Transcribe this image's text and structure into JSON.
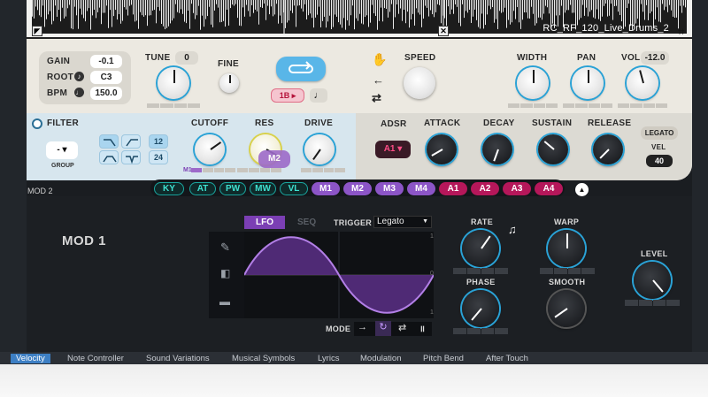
{
  "waveform": {
    "file_name": "RC_RF_120_Live_Drums_2"
  },
  "global": {
    "gain_label": "GAIN",
    "gain_value": "-0.1",
    "root_label": "ROOT",
    "root_value": "C3",
    "bpm_label": "BPM",
    "bpm_value": "150.0"
  },
  "tune": {
    "label": "TUNE",
    "value": "0"
  },
  "fine": {
    "label": "FINE"
  },
  "playback": {
    "slice_label": "1B"
  },
  "speed": {
    "label": "SPEED"
  },
  "width": {
    "label": "WIDTH"
  },
  "pan": {
    "label": "PAN"
  },
  "vol": {
    "label": "VOL",
    "value": "-12.0"
  },
  "filter": {
    "label": "FILTER",
    "group_value": "-",
    "group_label": "GROUP",
    "slope_12": "12",
    "slope_24": "24",
    "cutoff_label": "CUTOFF",
    "cutoff_mod_tag": "M1",
    "res_label": "RES",
    "res_drag_tag": "M2",
    "drive_label": "DRIVE"
  },
  "envelope": {
    "adsr_label": "ADSR",
    "env_value": "A1",
    "attack_label": "ATTACK",
    "decay_label": "DECAY",
    "sustain_label": "SUSTAIN",
    "release_label": "RELEASE",
    "legato_label": "LEGATO",
    "vel_label": "VEL",
    "vel_value": "40"
  },
  "mod_tabs": [
    "KY",
    "AT",
    "PW",
    "MW",
    "VL",
    "M1",
    "M2",
    "M3",
    "M4",
    "A1",
    "A2",
    "A3",
    "A4"
  ],
  "mod2_label": "MOD 2",
  "mod1": {
    "title": "MOD 1",
    "tab_lfo": "LFO",
    "tab_seq": "SEQ",
    "trigger_label": "TRIGGER",
    "trigger_value": "Legato",
    "mode_label": "MODE",
    "rate_label": "RATE",
    "phase_label": "PHASE",
    "warp_label": "WARP",
    "smooth_label": "SMOOTH",
    "level_label": "LEVEL"
  },
  "bottom_tabs": [
    "Velocity",
    "Note Controller",
    "Sound Variations",
    "Musical Symbols",
    "Lyrics",
    "Modulation",
    "Pitch Bend",
    "After Touch"
  ],
  "colors": {
    "accent_blue": "#2aa2d6",
    "mod_purple": "#7b3fb4",
    "env_pink": "#c2185b",
    "mod_cyan": "#1aa7a0"
  }
}
